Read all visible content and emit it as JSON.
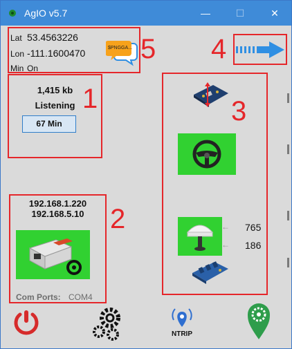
{
  "window": {
    "title": "AgIO v5.7",
    "minimize": "—",
    "maximize": "☐",
    "close": "✕"
  },
  "gps_position": {
    "lat_label": "Lat",
    "lat_value": "53.4563226",
    "lon_label": "Lon",
    "lon_value": "-111.1600470",
    "min_label": "Min",
    "min_value": "On"
  },
  "nmea": {
    "badge": "$PNGGA..."
  },
  "status_panel": {
    "data_rate": "1,415 kb",
    "state": "Listening",
    "timer_button": "67 Min"
  },
  "network": {
    "ip_1": "192.168.1.220",
    "ip_2": "192.168.5.10",
    "com_ports_label": "Com Ports:",
    "com_ports_value": "COM4"
  },
  "modules": {
    "gps_value_1": "765",
    "gps_value_2": "186"
  },
  "toolbar": {
    "ntrip_label": "NTRIP"
  },
  "callouts": {
    "n1": "1",
    "n2": "2",
    "n3": "3",
    "n4": "4",
    "n5": "5"
  },
  "colors": {
    "titlebar": "#3f8bd8",
    "callout_red": "#e5262a",
    "tile_green": "#31d131",
    "power_red": "#d62b2b",
    "arrow_blue": "#2f8fe3"
  }
}
